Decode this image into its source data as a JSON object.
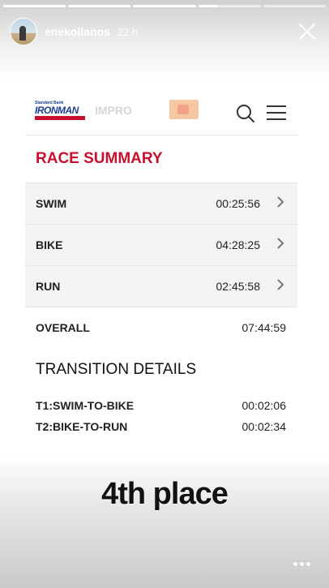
{
  "story": {
    "username": "enekollanos",
    "timestamp": "22 h",
    "segments": [
      {
        "progress": 1.0
      },
      {
        "progress": 1.0
      },
      {
        "progress": 1.0
      },
      {
        "progress": 0.3
      },
      {
        "progress": 0.0
      }
    ]
  },
  "site": {
    "logo_small": "Standard Bank",
    "logo_brand": "IRONMAN",
    "faint_text": "IMPRO",
    "brand_color": "#c8102e"
  },
  "race_summary": {
    "title": "RACE SUMMARY",
    "rows": [
      {
        "label": "SWIM",
        "time": "00:25:56"
      },
      {
        "label": "BIKE",
        "time": "04:28:25"
      },
      {
        "label": "RUN",
        "time": "02:45:58"
      }
    ],
    "overall": {
      "label": "OVERALL",
      "time": "07:44:59"
    }
  },
  "transition_details": {
    "title": "TRANSITION DETAILS",
    "rows": [
      {
        "label": "T1:SWIM-TO-BIKE",
        "time": "00:02:06"
      },
      {
        "label": "T2:BIKE-TO-RUN",
        "time": "00:02:34"
      }
    ]
  },
  "caption": "4th place"
}
